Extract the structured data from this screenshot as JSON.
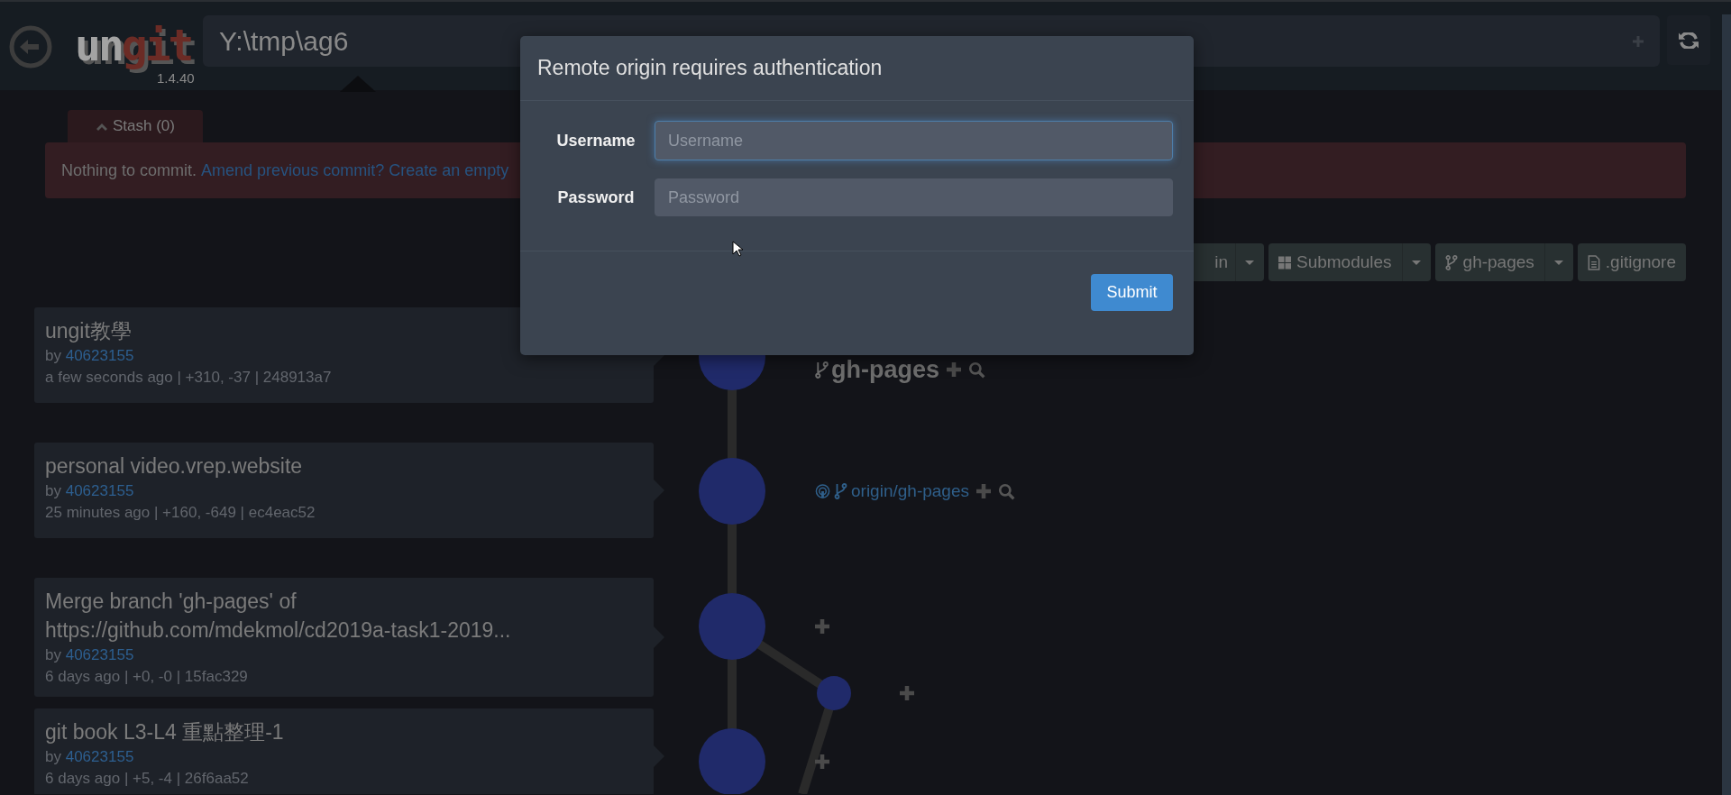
{
  "header": {
    "logo": [
      {
        "text": "un",
        "color": "#a3a3a3"
      },
      {
        "text": "git",
        "color": "#6b2b25"
      }
    ],
    "version": "1.4.40",
    "path": "Y:\\tmp\\ag6"
  },
  "stash": {
    "label": "Stash (0)"
  },
  "banner": {
    "text": "Nothing to commit.",
    "link": "Amend previous commit? Create an empty"
  },
  "toolbar": [
    {
      "kind": "remote",
      "label": "in",
      "dropdown": true
    },
    {
      "kind": "submodules",
      "label": "Submodules",
      "dropdown": true
    },
    {
      "kind": "branch",
      "label": "gh-pages",
      "dropdown": true
    },
    {
      "kind": "file",
      "label": ".gitignore",
      "dropdown": false
    }
  ],
  "commits": [
    {
      "title": "ungit教學",
      "by": "by",
      "author": "40623155",
      "meta": "a few seconds ago | +310, -37 | 248913a7"
    },
    {
      "title": "personal video.vrep.website",
      "by": "by",
      "author": "40623155",
      "meta": "25 minutes ago | +160, -649 | ec4eac52"
    },
    {
      "title": "Merge branch 'gh-pages' of https://github.com/mdekmol/cd2019a-task1-2019...",
      "by": "by",
      "author": "40623155",
      "meta": "6 days ago | +0, -0 | 15fac329"
    },
    {
      "title": "git book L3-L4 重點整理-1",
      "by": "by",
      "author": "40623155",
      "meta": "6 days ago | +5, -4 | 26f6aa52"
    }
  ],
  "graph": {
    "nodes": [
      {
        "kind": "main",
        "refs": [
          {
            "kind": "local",
            "label": "gh-pages"
          }
        ]
      },
      {
        "kind": "main",
        "refs": [
          {
            "kind": "remote",
            "label": "origin/gh-pages"
          }
        ]
      },
      {
        "kind": "main"
      },
      {
        "kind": "side"
      },
      {
        "kind": "main"
      }
    ]
  },
  "modal": {
    "title": "Remote origin requires authentication",
    "fields": [
      {
        "label": "Username",
        "placeholder": "Username",
        "focused": true
      },
      {
        "label": "Password",
        "placeholder": "Password",
        "focused": false
      }
    ],
    "submit": "Submit"
  }
}
